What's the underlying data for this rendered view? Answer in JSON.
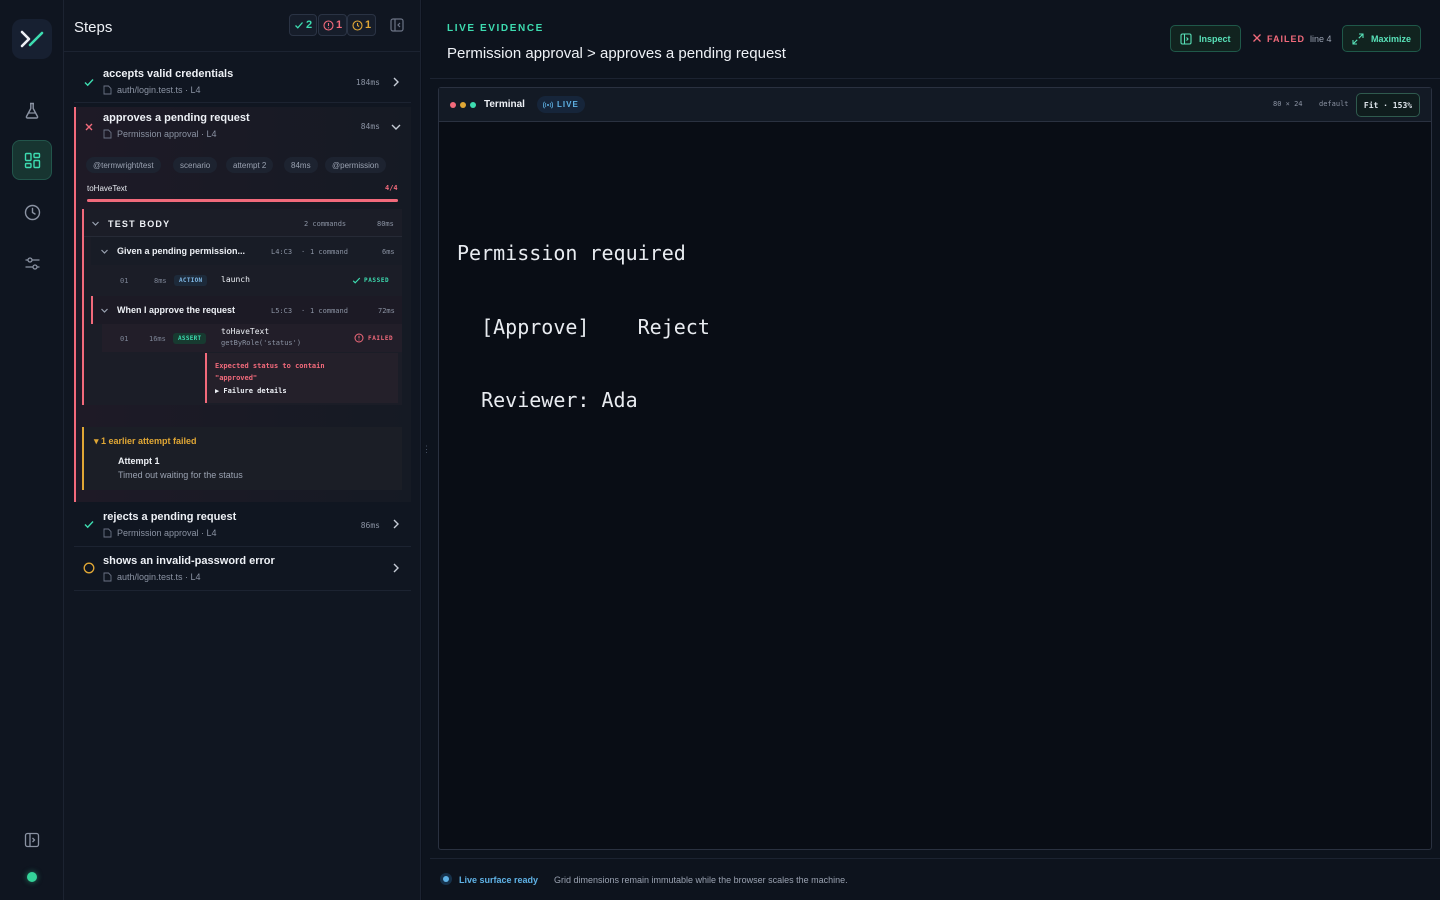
{
  "steps_panel": {
    "title": "Steps",
    "counts": {
      "passed": "2",
      "failed": "1",
      "pending": "1"
    }
  },
  "tests": [
    {
      "status": "passed",
      "name": "accepts valid credentials",
      "file": "auth/login.test.ts · L4",
      "duration": "184ms"
    },
    {
      "status": "failed",
      "name": "approves a pending request",
      "file": "Permission approval · L4",
      "duration": "84ms"
    },
    {
      "status": "passed",
      "name": "rejects a pending request",
      "file": "Permission approval · L4",
      "duration": "86ms"
    },
    {
      "status": "pending",
      "name": "shows an invalid-password error",
      "file": "auth/login.test.ts · L4",
      "duration": ""
    }
  ],
  "detail": {
    "tags": [
      "@termwright/test",
      "scenario",
      "attempt 2",
      "84ms",
      "@permission"
    ],
    "assertion": {
      "name": "toHaveText",
      "progress_label": "4/4",
      "progress": 1.0
    },
    "test_body": {
      "label": "TEST BODY",
      "commands": "2 commands",
      "duration": "80ms"
    },
    "given": {
      "label": "Given a pending permission...",
      "loc": "L4:C3",
      "commands": "1 command",
      "duration": "6ms",
      "cmd": {
        "index": "01",
        "duration": "8ms",
        "kind": "ACTION",
        "name": "launch",
        "status": "PASSED"
      }
    },
    "when": {
      "label": "When I approve the request",
      "loc": "L5:C3",
      "commands": "1 command",
      "duration": "72ms",
      "cmd": {
        "index": "01",
        "duration": "16ms",
        "kind": "ASSERT",
        "name": "toHaveText",
        "arg": "getByRole('status')",
        "status": "FAILED"
      }
    },
    "failure": {
      "message_line1": "Expected status to contain",
      "message_line2": "\"approved\"",
      "details": "▶ Failure details"
    },
    "earlier": {
      "title": "▾ 1 earlier attempt failed",
      "attempt": "Attempt 1",
      "reason": "Timed out waiting for the status"
    }
  },
  "header": {
    "kicker": "LIVE EVIDENCE",
    "breadcrumb": "Permission approval > approves a pending request",
    "inspect_label": "Inspect",
    "status_label": "FAILED",
    "line_label": "line 4",
    "maximize_label": "Maximize"
  },
  "terminal": {
    "title": "Terminal",
    "live_label": "LIVE",
    "dims": "80 × 24",
    "theme": "default",
    "fit_label": "Fit · 153%",
    "lines": [
      "Permission required",
      "  [Approve]    Reject",
      "  Reviewer: Ada"
    ]
  },
  "footer": {
    "status": "Live surface ready",
    "message": "Grid dimensions remain immutable while the browser scales the machine."
  },
  "colors": {
    "accent": "#3ddcb0",
    "fail": "#f26a7b",
    "warn": "#e0a735"
  }
}
